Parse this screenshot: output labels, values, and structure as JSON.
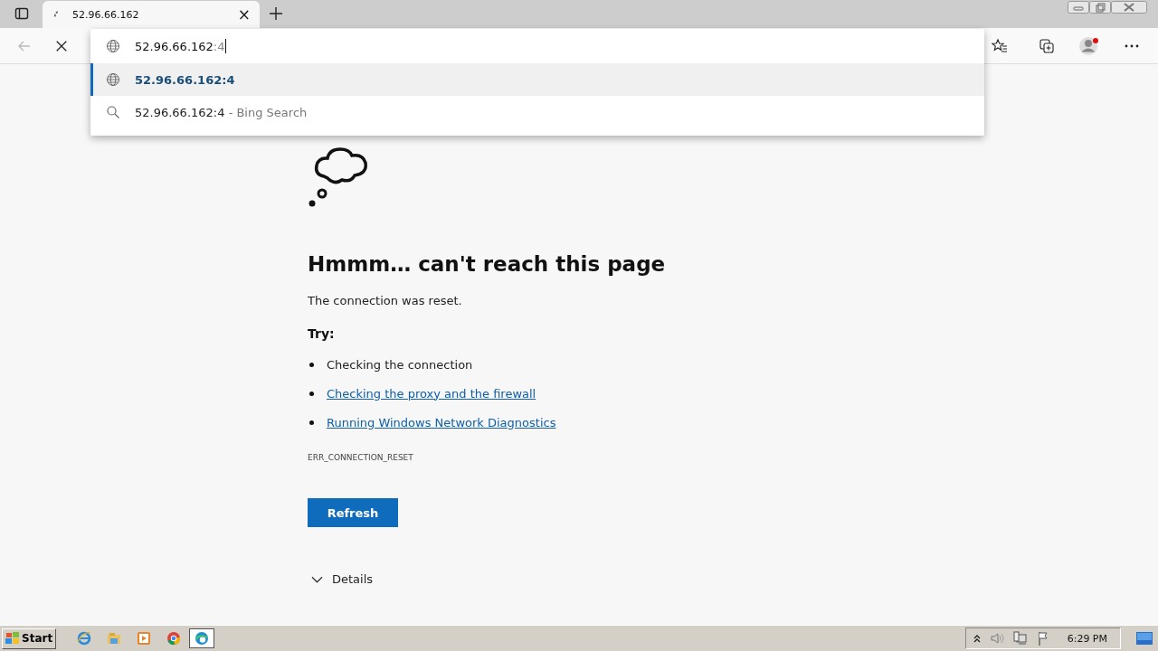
{
  "tab": {
    "title": "52.96.66.162",
    "close": "×"
  },
  "address_bar": {
    "typed": "52.96.66.162",
    "completion": ":4"
  },
  "suggestions": [
    {
      "kind": "url",
      "text": "52.96.66.162:4",
      "selected": true
    },
    {
      "kind": "search",
      "text": "52.96.66.162:4",
      "suffix": " - Bing Search",
      "selected": false
    }
  ],
  "error_page": {
    "heading": "Hmmm… can't reach this page",
    "message": "The connection was reset.",
    "try_label": "Try:",
    "tips": [
      {
        "text": "Checking the connection",
        "link": false
      },
      {
        "text": "Checking the proxy and the firewall",
        "link": true
      },
      {
        "text": "Running Windows Network Diagnostics",
        "link": true
      }
    ],
    "code": "ERR_CONNECTION_RESET",
    "button": "Refresh",
    "details": "Details"
  },
  "taskbar": {
    "start": "Start",
    "clock": "6:29 PM"
  }
}
